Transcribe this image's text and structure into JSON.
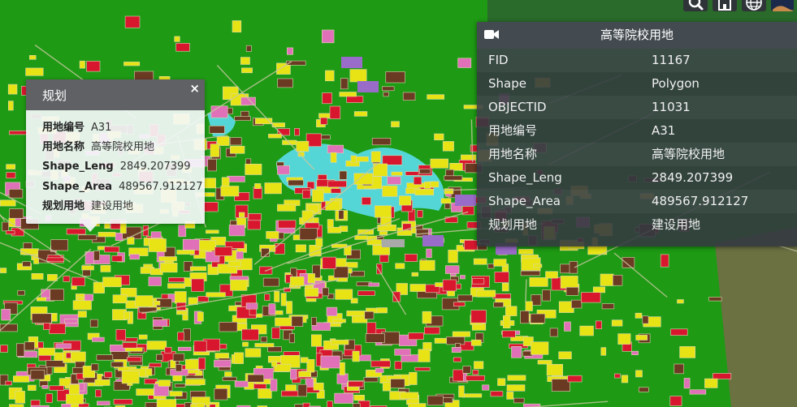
{
  "toolbar": {
    "icons": [
      "search-icon",
      "home-icon",
      "globe-icon",
      "user-avatar"
    ]
  },
  "popup": {
    "title": "规划",
    "close_label": "×",
    "rows": [
      {
        "key": "用地编号",
        "value": "A31"
      },
      {
        "key": "用地名称",
        "value": "高等院校用地"
      },
      {
        "key": "Shape_Leng",
        "value": "2849.207399"
      },
      {
        "key": "Shape_Area",
        "value": "489567.912127"
      },
      {
        "key": "规划用地",
        "value": "建设用地"
      }
    ]
  },
  "panel": {
    "title": "高等院校用地",
    "icon": "camera-icon",
    "rows": [
      {
        "key": "FID",
        "value": "11167"
      },
      {
        "key": "Shape",
        "value": "Polygon"
      },
      {
        "key": "OBJECTID",
        "value": "11031"
      },
      {
        "key": "用地编号",
        "value": "A31"
      },
      {
        "key": "用地名称",
        "value": "高等院校用地"
      },
      {
        "key": "Shape_Leng",
        "value": "2849.207399"
      },
      {
        "key": "Shape_Area",
        "value": "489567.912127"
      },
      {
        "key": "规划用地",
        "value": "建设用地"
      }
    ]
  },
  "colors": {
    "green": "#1e9a14",
    "yellow": "#e8e314",
    "red": "#d8172f",
    "brown": "#6b3a23",
    "pink": "#e070b8",
    "cyan": "#54d6d6",
    "purple": "#9a6cc9",
    "gray": "#a9a9a9",
    "road": "#c9c9a0"
  }
}
